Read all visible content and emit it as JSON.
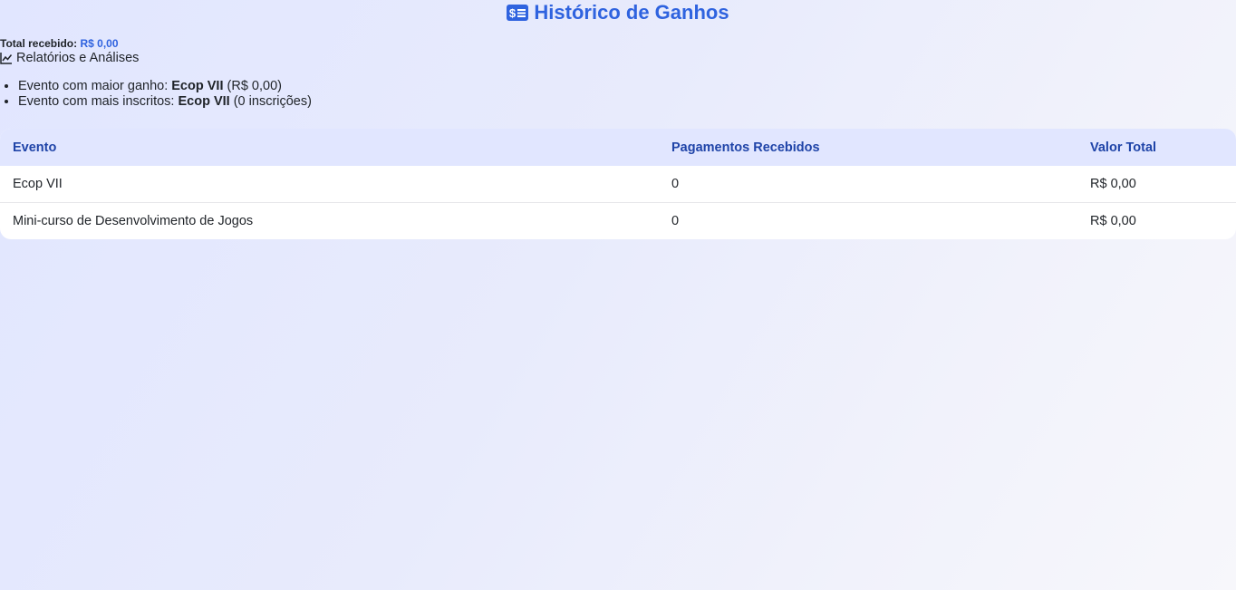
{
  "header": {
    "title": "Histórico de Ganhos",
    "icon": "money-bill-icon",
    "accent_color": "#2f63df"
  },
  "summary": {
    "total_label": "Total recebido:",
    "total_value": "R$ 0,00"
  },
  "reports": {
    "icon": "chart-line-icon",
    "label": "Relatórios e Análises"
  },
  "stats": {
    "highest_gain": {
      "prefix": "Evento com maior ganho: ",
      "event": "Ecop VII",
      "detail": " (R$ 0,00)"
    },
    "most_subscriptions": {
      "prefix": "Evento com mais inscritos: ",
      "event": "Ecop VII",
      "detail": " (0 inscrições)"
    }
  },
  "table": {
    "headers": [
      "Evento",
      "Pagamentos Recebidos",
      "Valor Total"
    ],
    "rows": [
      [
        "Ecop VII",
        "0",
        "R$ 0,00"
      ],
      [
        "Mini-curso de Desenvolvimento de Jogos",
        "0",
        "R$ 0,00"
      ]
    ]
  }
}
